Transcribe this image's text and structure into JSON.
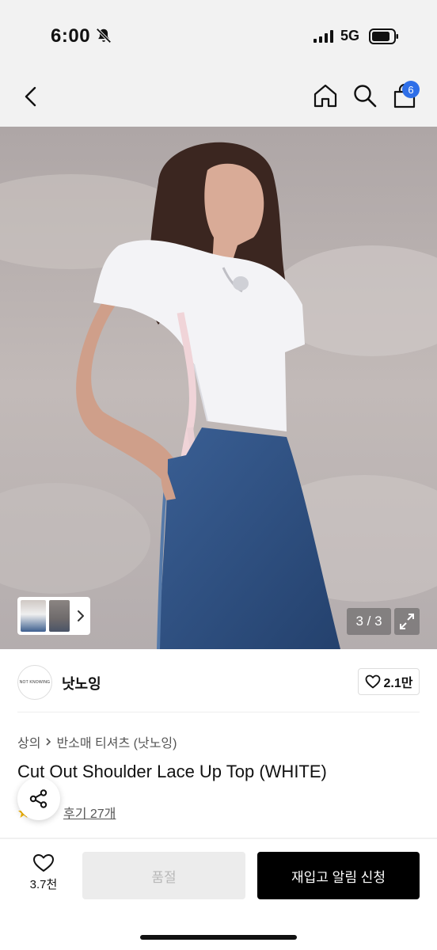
{
  "status_bar": {
    "time": "6:00",
    "network": "5G"
  },
  "nav": {
    "cart_count": "6"
  },
  "gallery": {
    "counter": "3 / 3"
  },
  "brand": {
    "logo_text": "NOT KNOWING",
    "name": "낫노잉",
    "likes": "2.1만"
  },
  "breadcrumb": {
    "category": "상의",
    "subcategory": "반소매 티셔츠 (낫노잉)"
  },
  "product": {
    "title": "Cut Out Shoulder Lace Up Top (WHITE)",
    "reviews": "후기 27개"
  },
  "bottom_bar": {
    "wish_count": "3.7천",
    "soldout_label": "품절",
    "restock_label": "재입고 알림 신청"
  },
  "colors": {
    "accent_badge": "#2f6fe8",
    "primary_button": "#000000",
    "disabled_button": "#ececec"
  },
  "icons": [
    "bell-off-icon",
    "signal-icon",
    "battery-icon",
    "back-icon",
    "home-icon",
    "search-icon",
    "shopping-bag-icon",
    "chevron-right-icon",
    "expand-icon",
    "heart-icon",
    "share-icon",
    "star-icon"
  ]
}
